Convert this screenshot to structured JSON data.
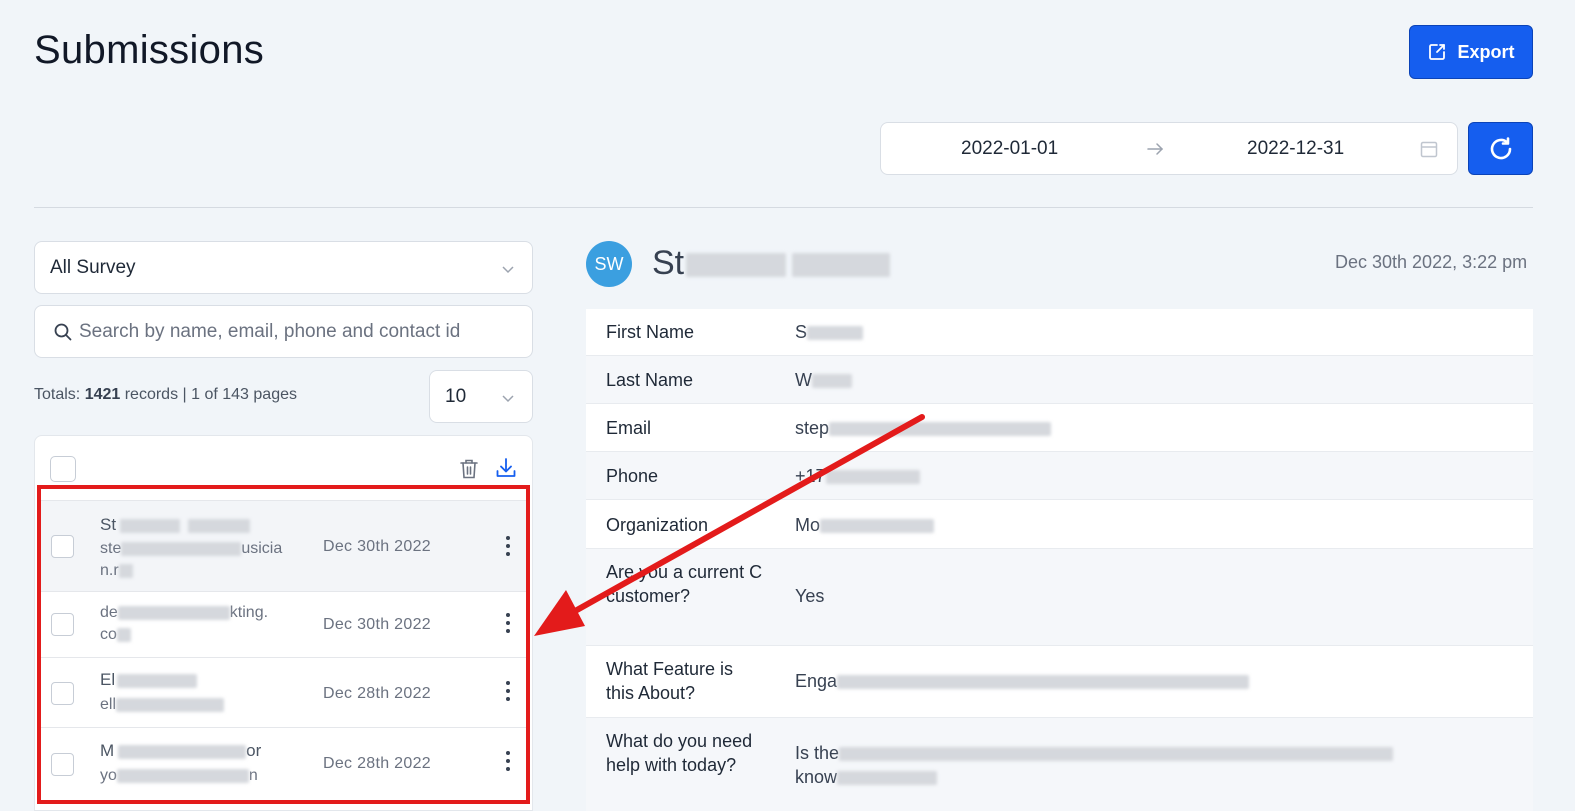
{
  "header": {
    "title": "Submissions",
    "export_label": "Export"
  },
  "date_range": {
    "start": "2022-01-01",
    "end": "2022-12-31"
  },
  "filters": {
    "survey_selected": "All Survey",
    "search_placeholder": "Search by name, email, phone and contact id",
    "totals_prefix": "Totals: ",
    "totals_count": "1421",
    "totals_suffix": " records | 1 of 143 pages",
    "page_size": "10"
  },
  "list": {
    "rows": [
      {
        "name": "St",
        "email": "ste",
        "email_tail": "usicia",
        "email_line2": "n.r",
        "date": "Dec 30th 2022"
      },
      {
        "name": "",
        "email": "de",
        "email_tail": "kting.",
        "email_line2": "co",
        "date": "Dec 30th 2022"
      },
      {
        "name": "El",
        "email": "ell",
        "email_tail": "",
        "email_line2": "",
        "date": "Dec 28th 2022"
      },
      {
        "name": "M",
        "name_tail": "or",
        "email": "yo",
        "email_tail": "n",
        "email_line2": "",
        "date": "Dec 28th 2022"
      }
    ]
  },
  "detail": {
    "avatar_initials": "SW",
    "contact_name": "St",
    "submitted_at": "Dec 30th 2022, 3:22 pm",
    "fields": [
      {
        "label": "First Name",
        "value": "S"
      },
      {
        "label": "Last Name",
        "value": "W"
      },
      {
        "label": "Email",
        "value": "step"
      },
      {
        "label": "Phone",
        "value": "+17"
      },
      {
        "label": "Organization",
        "value": "Mo"
      },
      {
        "label": "Are you a current C customer?",
        "value": "Yes"
      },
      {
        "label": "What Feature is this About?",
        "value": "Enga"
      },
      {
        "label": "What do you need help with today?",
        "value": "Is the",
        "value_line2": "know"
      }
    ]
  },
  "colors": {
    "primary": "#155eef",
    "highlight": "#e31b1b",
    "avatar": "#3b9fe0"
  }
}
